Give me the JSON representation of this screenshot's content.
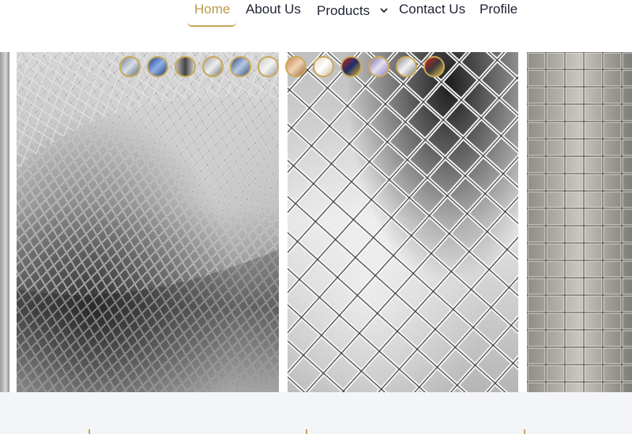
{
  "nav": {
    "items": [
      {
        "label": "Home",
        "active": true
      },
      {
        "label": "About Us"
      },
      {
        "label": "Products",
        "dropdown": true
      },
      {
        "label": "Contact Us"
      },
      {
        "label": "Profile"
      }
    ]
  },
  "gallery": {
    "panels": [
      {
        "name": "chain-link-mesh-roll"
      },
      {
        "name": "stainless-crimped-mesh"
      },
      {
        "name": "welded-wire-mesh-roll"
      }
    ],
    "thumbnail_count": 12
  },
  "colors": {
    "accent_gold": "#c9a85b",
    "active_text": "#b89a4e",
    "nav_text": "#1f2433",
    "footer_bg": "#f4f5f9"
  }
}
